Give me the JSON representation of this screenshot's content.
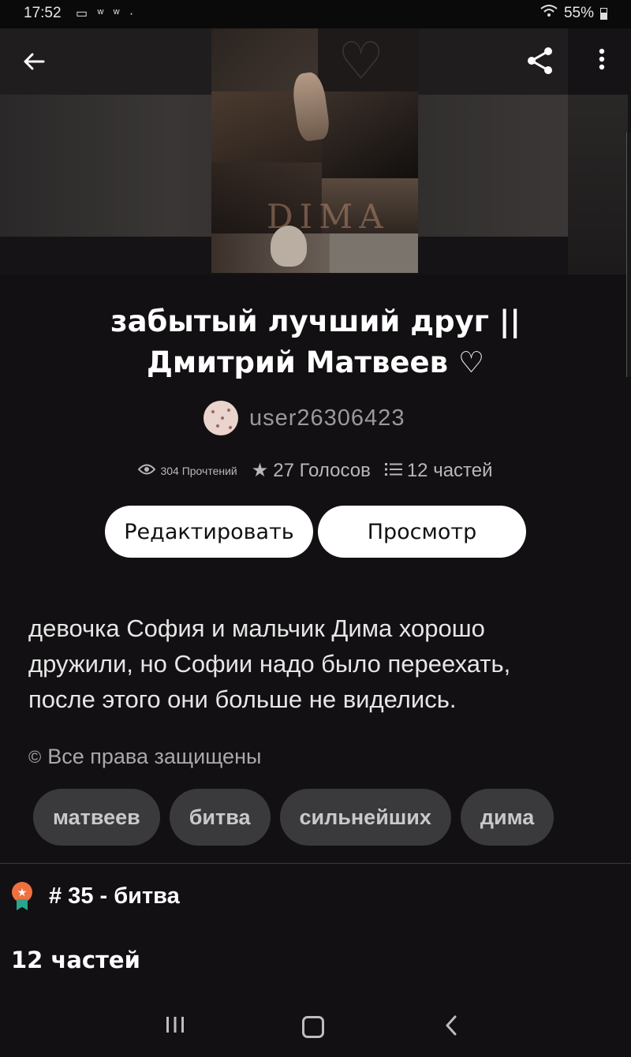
{
  "status_bar": {
    "time": "17:52",
    "notification_icons": "▭ ʷ ʷ ·",
    "battery": "55%"
  },
  "cover": {
    "text": "DIMA"
  },
  "story": {
    "title": "забытый лучший друг || Дмитрий Матвеев ♡",
    "author": "user26306423",
    "reads": "304 Прочтений",
    "votes": "27 Голосов",
    "parts": "12 частей",
    "description": "девочка София  и мальчик  Дима хорошо дружили, но Софии  надо было  переехать, после этого они больше  не виделись.",
    "copyright": "Все права защищены"
  },
  "actions": {
    "edit_label": "Редактировать",
    "view_label": "Просмотр"
  },
  "tags": [
    "матвеев",
    "битва",
    "сильнейших",
    "дима"
  ],
  "ranking": {
    "label": "# 35 - битва"
  },
  "parts_section": {
    "heading": "12 частей"
  },
  "colors": {
    "background": "#121012",
    "button_bg": "#ffffff",
    "tag_bg": "#3a3a3c",
    "medal": "#f07040",
    "medal_ribbon": "#2aa58a"
  }
}
